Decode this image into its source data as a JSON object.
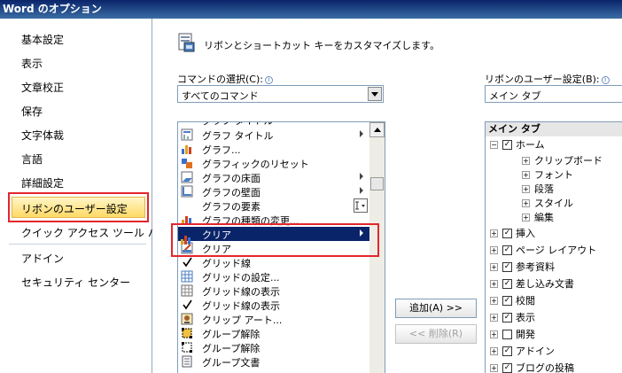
{
  "window": {
    "title": "Word のオプション"
  },
  "sidebar": {
    "items": [
      {
        "label": "基本設定"
      },
      {
        "label": "表示"
      },
      {
        "label": "文章校正"
      },
      {
        "label": "保存"
      },
      {
        "label": "文字体裁"
      },
      {
        "label": "言語"
      },
      {
        "label": "詳細設定"
      },
      {
        "label": "リボンのユーザー設定",
        "selected": true
      },
      {
        "label": "クイック アクセス ツール バー"
      },
      {
        "label": "アドイン"
      },
      {
        "label": "セキュリティ センター"
      }
    ]
  },
  "header": {
    "text": "リボンとショートカット キーをカスタマイズします。"
  },
  "commands": {
    "label": "コマンドの選択(C):",
    "combo_value": "すべてのコマンド",
    "items": [
      {
        "label": "グラフ タイトル",
        "icon": "chart-title-icon",
        "submenu": true
      },
      {
        "label": "グラフ...",
        "icon": "chart-icon"
      },
      {
        "label": "グラフィックのリセット",
        "icon": "reset-graphic-icon"
      },
      {
        "label": "グラフの床面",
        "icon": "chart-floor-icon",
        "submenu": true
      },
      {
        "label": "グラフの壁面",
        "icon": "chart-wall-icon",
        "submenu": true
      },
      {
        "label": "グラフの要素",
        "icon": "chart-elements-icon",
        "dropdown": true
      },
      {
        "label": "グラフの種類の変更...",
        "icon": "change-chart-type-icon"
      },
      {
        "label": "クリア",
        "icon": "clear-icon",
        "submenu": true,
        "selected": true
      },
      {
        "label": "クリア",
        "icon": "clear-format-icon"
      },
      {
        "label": "グリッド線",
        "icon": "check-icon"
      },
      {
        "label": "グリッドの設定...",
        "icon": "grid-settings-icon"
      },
      {
        "label": "グリッド線の表示",
        "icon": "gridlines-icon"
      },
      {
        "label": "グリッド線の表示",
        "icon": "check-icon"
      },
      {
        "label": "クリップ アート...",
        "icon": "clip-art-icon"
      },
      {
        "label": "グループ解除",
        "icon": "ungroup-icon"
      },
      {
        "label": "グループ解除",
        "icon": "ungroup-icon"
      },
      {
        "label": "グループ文書",
        "icon": "group-document-icon"
      }
    ]
  },
  "buttons": {
    "add": "追加(A) >>",
    "remove": "<< 削除(R)"
  },
  "ribbon": {
    "label": "リボンのユーザー設定(B):",
    "combo_value": "メイン タブ",
    "tree_header": "メイン タブ",
    "nodes": [
      {
        "label": "ホーム",
        "level": 0,
        "expand": "−",
        "checked": true
      },
      {
        "label": "クリップボード",
        "level": 1,
        "expand": "+"
      },
      {
        "label": "フォント",
        "level": 1,
        "expand": "+"
      },
      {
        "label": "段落",
        "level": 1,
        "expand": "+"
      },
      {
        "label": "スタイル",
        "level": 1,
        "expand": "+"
      },
      {
        "label": "編集",
        "level": 1,
        "expand": "+"
      },
      {
        "label": "挿入",
        "level": 0,
        "expand": "+",
        "checked": true
      },
      {
        "label": "ページ レイアウト",
        "level": 0,
        "expand": "+",
        "checked": true
      },
      {
        "label": "参考資料",
        "level": 0,
        "expand": "+",
        "checked": true
      },
      {
        "label": "差し込み文書",
        "level": 0,
        "expand": "+",
        "checked": true
      },
      {
        "label": "校閲",
        "level": 0,
        "expand": "+",
        "checked": true
      },
      {
        "label": "表示",
        "level": 0,
        "expand": "+",
        "checked": true
      },
      {
        "label": "開発",
        "level": 0,
        "expand": "+",
        "checked": false
      },
      {
        "label": "アドイン",
        "level": 0,
        "expand": "+",
        "checked": true
      },
      {
        "label": "ブログの投稿",
        "level": 0,
        "expand": "+",
        "checked": true
      }
    ]
  },
  "colors": {
    "titlebar": "#0a246a",
    "selection": "#0a246a",
    "highlight": "#e3262b",
    "sidebar_selected": "#ffd965"
  }
}
